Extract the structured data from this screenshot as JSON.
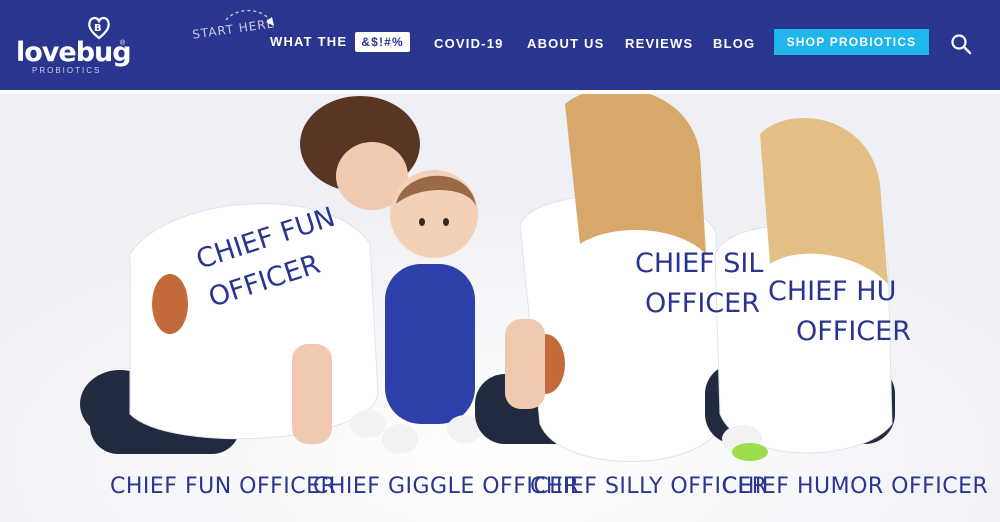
{
  "brand": {
    "name": "lovebug",
    "sub": "PROBIOTICS",
    "reg": "®",
    "color_primary": "#2a3590",
    "color_accent": "#1fb6ec"
  },
  "nav": {
    "start_here": "START HERE",
    "what_the": "WHAT THE",
    "what_badge": "&$!#%",
    "covid": "COVID-19",
    "about": "ABOUT US",
    "reviews": "REVIEWS",
    "blog": "BLOG",
    "shop": "SHOP PROBIOTICS",
    "search_icon": "search-icon"
  },
  "hero": {
    "shirts": {
      "kid1": [
        "CHIEF FUN",
        "OFFICER"
      ],
      "kid3": [
        "CHIEF SIL",
        "OFFICER"
      ],
      "kid4": [
        "CHIEF HU",
        "OFFICER"
      ]
    },
    "captions": [
      "CHIEF FUN OFFICER",
      "CHIEF GIGGLE OFFICER",
      "CHIEF SILLY OFFICER",
      "CHIEF HUMOR OFFICER"
    ]
  }
}
